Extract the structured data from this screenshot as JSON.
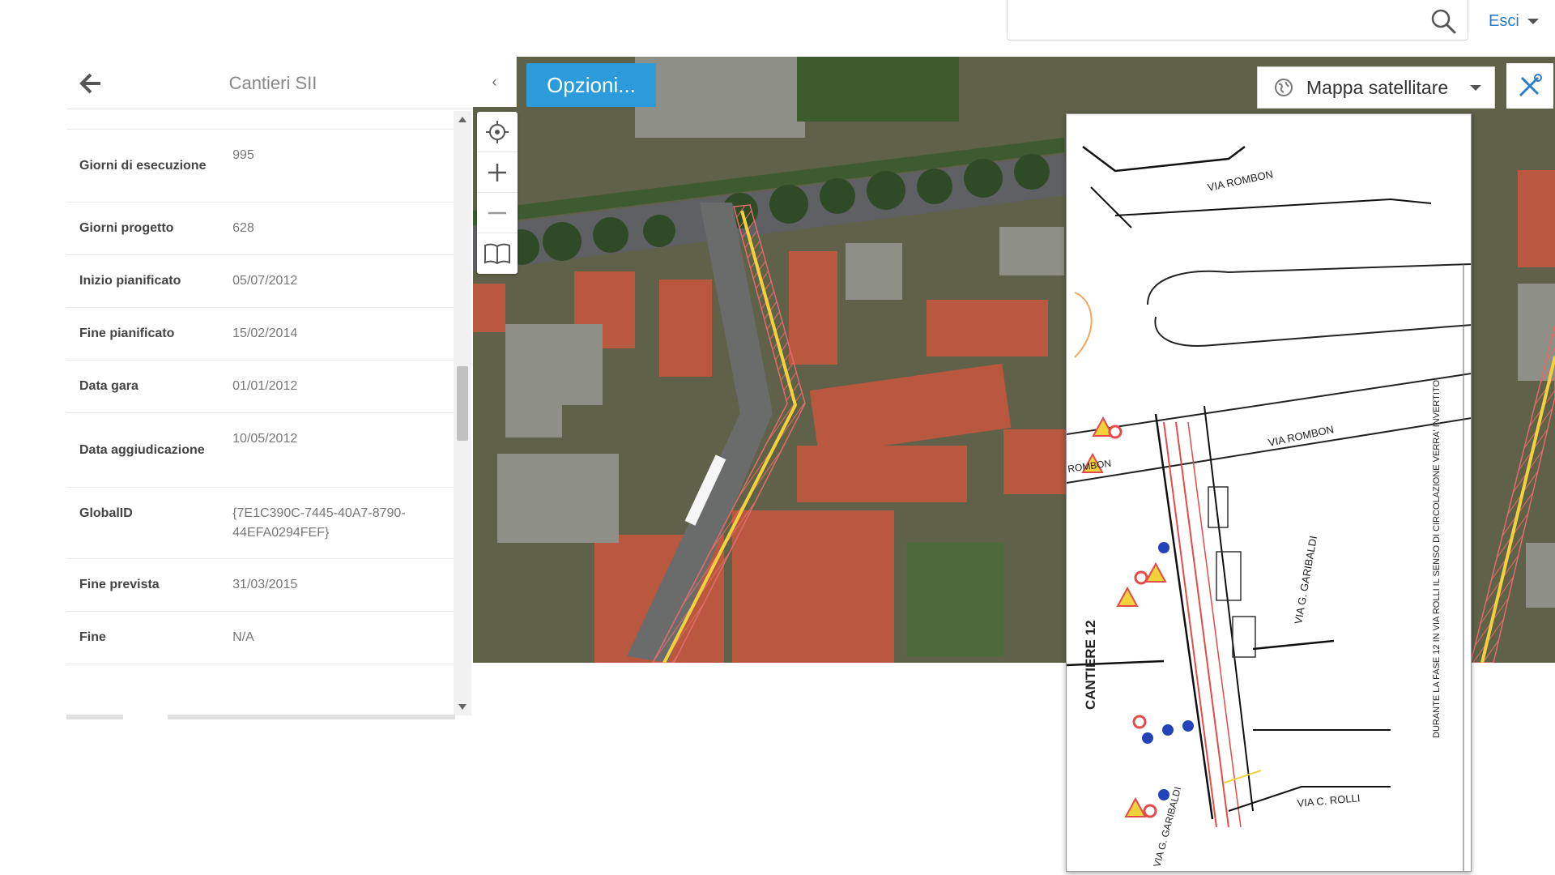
{
  "header": {
    "search_placeholder": "",
    "exit_label": "Esci"
  },
  "panel": {
    "title": "Cantieri SII",
    "attributes": [
      {
        "key": "Giorni di esecuzione",
        "value": "995"
      },
      {
        "key": "Giorni progetto",
        "value": "628"
      },
      {
        "key": "Inizio pianificato",
        "value": "05/07/2012"
      },
      {
        "key": "Fine pianificato",
        "value": "15/02/2014"
      },
      {
        "key": "Data gara",
        "value": "01/01/2012"
      },
      {
        "key": "Data aggiudicazione",
        "value": "10/05/2012"
      },
      {
        "key": "GlobalID",
        "value": "{7E1C390C-7445-40A7-8790-44EFA0294FEF}"
      },
      {
        "key": "Fine prevista",
        "value": "31/03/2015"
      },
      {
        "key": "Fine",
        "value": "N/A"
      }
    ]
  },
  "map": {
    "collapse_label": "‹",
    "options_label": "Opzioni...",
    "basemap_label": "Mappa satellitare",
    "tools": [
      "locate-icon",
      "zoom-in-icon",
      "zoom-out-icon",
      "bookmarks-icon"
    ]
  },
  "plan": {
    "labels": {
      "via_rombon_top": "VIA ROMBON",
      "via_rombon_mid": "VIA ROMBON",
      "rombon_left": "ROMBON",
      "via_garibaldi": "VIA G. GARIBALDI",
      "cantiere": "CANTIERE 12",
      "via_rolli": "VIA C. ROLLI",
      "via_garibaldi_bottom": "VIA G. GARIBALDI",
      "side_note": "DURANTE LA FASE 12 IN VIA ROLLI IL SENSO DI CIRCOLAZIONE VERRA' INVERTITO"
    }
  },
  "colors": {
    "accent": "#2b9bdc",
    "link": "#2a7dc4",
    "highlight": "#f2d23a",
    "hatch": "#e36b6b"
  }
}
